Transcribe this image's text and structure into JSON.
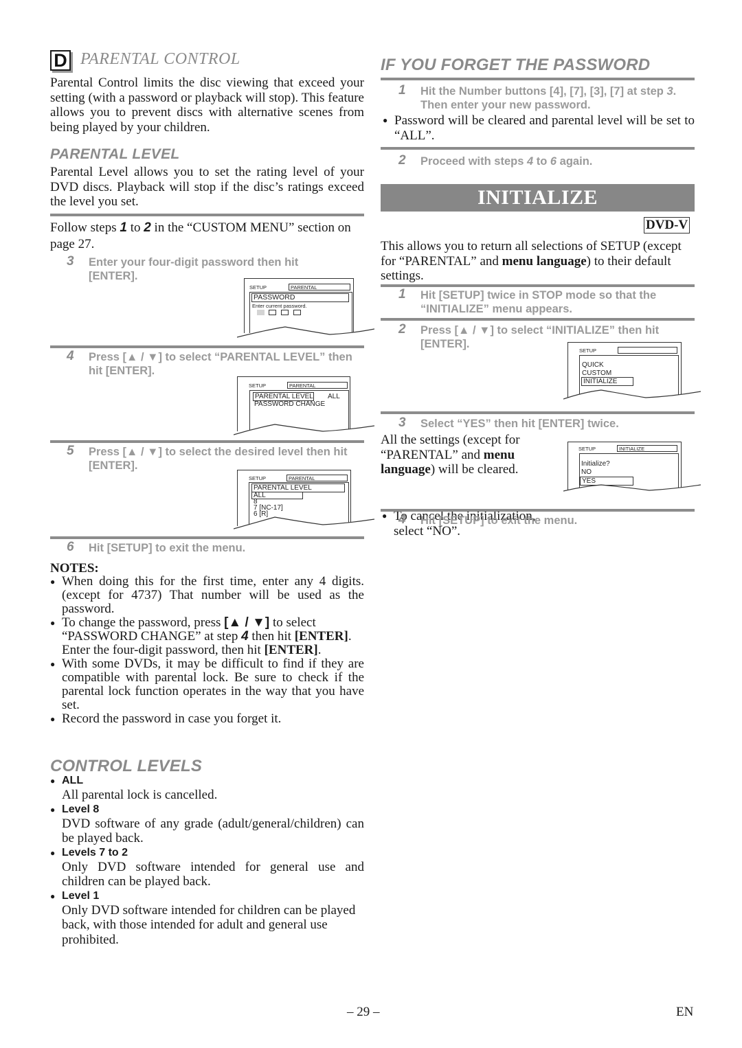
{
  "parental_control": {
    "badge": "D",
    "title": "PARENTAL CONTROL",
    "intro": "Parental Control limits the disc viewing that exceed your setting (with a password or playback will stop). This feature allows you to prevent discs with alternative scenes from being played by your children.",
    "level_heading": "PARENTAL LEVEL",
    "level_intro": "Parental Level allows you to set the rating level of your DVD discs. Playback will stop if the disc’s ratings exceed the level you set.",
    "follow_pre": "Follow steps ",
    "follow_step_a": "1",
    "follow_mid": " to ",
    "follow_step_b": "2",
    "follow_post": " in the “CUSTOM MENU” section on page 27.",
    "steps": [
      {
        "num": "3",
        "text": "Enter your four-digit password then hit [ENTER]."
      },
      {
        "num": "4",
        "text": "Press [▲ / ▼] to select “PARENTAL LEVEL” then hit [ENTER]."
      },
      {
        "num": "5",
        "text": "Press [▲ / ▼] to select the desired level then hit [ENTER]."
      },
      {
        "num": "6",
        "text": "Hit [SETUP] to exit the menu."
      }
    ],
    "screens": {
      "password": {
        "setup": "SETUP",
        "tab": "PARENTAL",
        "title": "PASSWORD",
        "prompt": "Enter current password.",
        "digits_total": 4,
        "digits_active": 1
      },
      "menu": {
        "setup": "SETUP",
        "tab": "PARENTAL",
        "items": [
          "PARENTAL LEVEL",
          "PASSWORD CHANGE"
        ],
        "selected": "PARENTAL LEVEL",
        "value": "ALL"
      },
      "levels": {
        "setup": "SETUP",
        "tab": "PARENTAL",
        "title": "PARENTAL LEVEL",
        "items": [
          "ALL",
          "8",
          "7 [NC-17]",
          "6 [R]"
        ],
        "selected": "ALL"
      }
    }
  },
  "notes": {
    "title": "NOTES:",
    "items": [
      "When doing this for the first time, enter any 4 digits. (except for 4737) That number will be used as the password.",
      "To change the password, press [▲ / ▼] to select “PASSWORD CHANGE” at step 4 then hit [ENTER]. Enter the four-digit password, then hit [ENTER].",
      "With some DVDs, it may be difficult to find if they are compatible with parental lock. Be sure to check if the parental lock function operates in the way that you have set.",
      "Record the password in case you forget it."
    ],
    "item2_parts": {
      "a": "To change the password, press ",
      "b": "[▲ / ▼]",
      "c": " to select “PASSWORD CHANGE” at step ",
      "d": "4",
      "e": " then hit ",
      "f": "[ENTER]",
      "g": ". Enter the four-digit password, then hit ",
      "h": "[ENTER]",
      "i": "."
    }
  },
  "control_levels": {
    "heading": "CONTROL LEVELS",
    "items": [
      {
        "label": "ALL",
        "desc": "All parental lock is cancelled."
      },
      {
        "label": "Level 8",
        "desc": "DVD software of any grade (adult/general/children) can be played back."
      },
      {
        "label": "Levels 7 to 2",
        "desc": "Only DVD software intended for general use and children can be played back."
      },
      {
        "label": "Level 1",
        "desc": "Only DVD software intended for children can be played back, with those intended for adult and general use prohibited."
      }
    ]
  },
  "forget_password": {
    "heading": "IF YOU FORGET THE PASSWORD",
    "step1_num": "1",
    "step1_a": "Hit the Number buttons [4], [7], [3], [7] at step ",
    "step1_b": "3",
    "step1_c": ". Then enter your new password.",
    "bullet": "Password will be cleared and parental level will be set to “ALL”.",
    "step2_num": "2",
    "step2_a": "Proceed with steps ",
    "step2_b": "4",
    "step2_c": " to ",
    "step2_d": "6",
    "step2_e": " again."
  },
  "initialize": {
    "banner": "INITIALIZE",
    "badge": "DVD-V",
    "intro_a": "This allows you to return all selections of SETUP (except for “PARENTAL” and ",
    "intro_b": "menu language",
    "intro_c": ") to their default settings.",
    "steps": [
      {
        "num": "1",
        "text": "Hit [SETUP] twice in STOP mode so that the “INITIALIZE” menu appears."
      },
      {
        "num": "2",
        "text": "Press [▲ / ▼] to select “INITIALIZE” then hit [ENTER]."
      },
      {
        "num": "3",
        "text": "Select “YES” then hit [ENTER] twice."
      },
      {
        "num": "4",
        "text": "Hit [SETUP] to exit the menu."
      }
    ],
    "cleared_a": "All the settings (except for “PARENTAL” and ",
    "cleared_b": "menu language",
    "cleared_c": ") will be cleared.",
    "cancel_bullet": "To cancel the initialization, select “NO”.",
    "screens": {
      "menu": {
        "setup": "SETUP",
        "tab": "",
        "items": [
          "QUICK",
          "CUSTOM",
          "INITIALIZE"
        ],
        "selected": "INITIALIZE"
      },
      "confirm": {
        "setup": "SETUP",
        "tab": "INITIALIZE",
        "question": "Initialize?",
        "items": [
          "NO",
          "YES"
        ],
        "selected": "YES"
      }
    }
  },
  "footer": {
    "page": "– 29 –",
    "lang": "EN"
  }
}
